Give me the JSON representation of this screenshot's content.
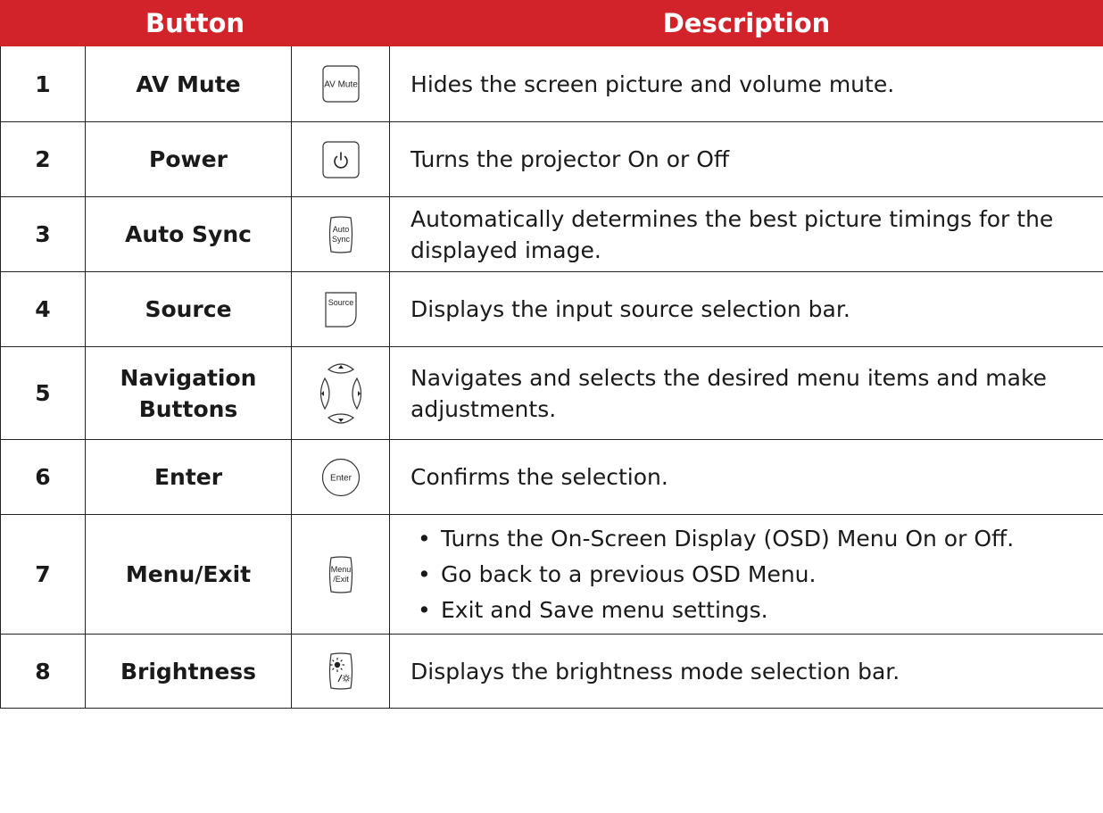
{
  "header": {
    "button": "Button",
    "description": "Description"
  },
  "rows": [
    {
      "num": "1",
      "name": "AV Mute",
      "icon": "av-mute-key-icon",
      "key_label": "AV Mute",
      "desc": "Hides the screen picture and volume mute."
    },
    {
      "num": "2",
      "name": "Power",
      "icon": "power-icon",
      "desc": "Turns the projector On or Off"
    },
    {
      "num": "3",
      "name": "Auto Sync",
      "icon": "auto-sync-key-icon",
      "key_label_1": "Auto",
      "key_label_2": "Sync",
      "desc": "Automatically determines the best picture timings for the displayed image."
    },
    {
      "num": "4",
      "name": "Source",
      "icon": "source-key-icon",
      "key_label": "Source",
      "desc": "Displays the input source selection bar."
    },
    {
      "num": "5",
      "name_1": "Navigation",
      "name_2": "Buttons",
      "icon": "navigation-pad-icon",
      "desc": "Navigates and selects the desired menu items and make adjustments."
    },
    {
      "num": "6",
      "name": "Enter",
      "icon": "enter-key-icon",
      "key_label": "Enter",
      "desc": "Confirms the selection."
    },
    {
      "num": "7",
      "name": "Menu/Exit",
      "icon": "menu-exit-key-icon",
      "key_label_1": "Menu",
      "key_label_2": "/Exit",
      "bullets": [
        "Turns the On-Screen Display (OSD) Menu On or Off.",
        "Go back to a previous OSD Menu.",
        "Exit and Save menu settings."
      ]
    },
    {
      "num": "8",
      "name": "Brightness",
      "icon": "brightness-key-icon",
      "desc": "Displays the brightness mode selection bar."
    }
  ],
  "colors": {
    "header_bg": "#d2232a",
    "header_text": "#ffffff",
    "border": "#222222"
  }
}
